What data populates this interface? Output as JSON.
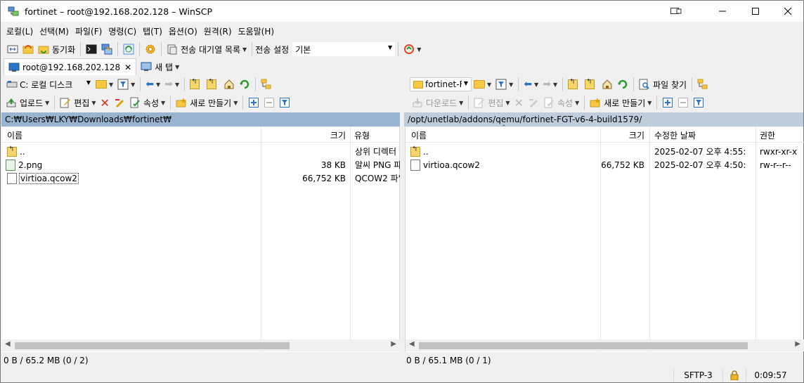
{
  "window": {
    "title": "fortinet – root@192.168.202.128 – WinSCP"
  },
  "menu": [
    "로컬(L)",
    "선택(M)",
    "파일(F)",
    "명령(C)",
    "탭(T)",
    "옵션(O)",
    "원격(R)",
    "도움말(H)"
  ],
  "toolbar": {
    "sync_label": "동기화",
    "queue_label": "전송 대기열 목록",
    "transfer_settings_label": "전송 설정",
    "transfer_preset": "기본"
  },
  "tabs": {
    "session": "root@192.168.202.128",
    "new_tab": "새 탭"
  },
  "left": {
    "drive": "C: 로컬 디스크",
    "upload_label": "업로드",
    "edit_label": "편집",
    "properties_label": "속성",
    "new_label": "새로 만들기",
    "path": "C:₩Users₩LKY₩Downloads₩fortinet₩",
    "columns": [
      "이름",
      "크기",
      "유형"
    ],
    "rows": [
      {
        "name": "..",
        "size": "",
        "type": "상위 디렉터"
      },
      {
        "name": "2.png",
        "size": "38 KB",
        "type": "알씨 PNG 파"
      },
      {
        "name": "virtioa.qcow2",
        "size": "66,752 KB",
        "type": "QCOW2 파'"
      }
    ],
    "status": "0 B / 65.2 MB (0 / 2)"
  },
  "right": {
    "dir": "fortinet-FC",
    "find_label": "파일 찾기",
    "download_label": "다운로드",
    "edit_label": "편집",
    "properties_label": "속성",
    "new_label": "새로 만들기",
    "path": "/opt/unetlab/addons/qemu/fortinet-FGT-v6-4-build1579/",
    "columns": [
      "이름",
      "크기",
      "수정한 날짜",
      "권한"
    ],
    "rows": [
      {
        "name": "..",
        "size": "",
        "date": "2025-02-07 오후 4:55:",
        "perm": "rwxr-xr-x"
      },
      {
        "name": "virtioa.qcow2",
        "size": "66,752 KB",
        "date": "2025-02-07 오후 4:50:",
        "perm": "rw-r--r--"
      }
    ],
    "status": "0 B / 65.1 MB (0 / 1)"
  },
  "bottom": {
    "protocol": "SFTP-3",
    "time": "0:09:57"
  },
  "colors": {
    "pathbar_active": "#99b4d1",
    "pathbar_inactive": "#bfcddb"
  }
}
